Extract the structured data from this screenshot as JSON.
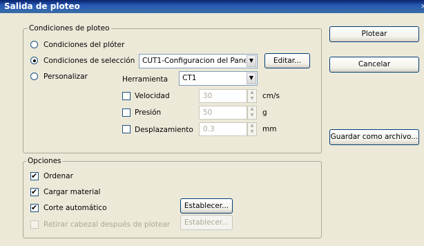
{
  "window": {
    "title": "Salida de ploteo",
    "close_glyph": "x"
  },
  "plot_conditions": {
    "legend": "Condiciones de ploteo",
    "plotter_conditions": "Condiciones del plóter",
    "selection_conditions": "Condiciones de selección",
    "custom": "Personalizar",
    "selected_profile": "CUT1-Configuracion del Pane",
    "edit_button": "Editar...",
    "tool_label": "Herramienta",
    "tool_value": "CT1",
    "speed": {
      "label": "Velocidad",
      "value": "30",
      "unit": "cm/s"
    },
    "pressure": {
      "label": "Presión",
      "value": "50",
      "unit": "g"
    },
    "offset": {
      "label": "Desplazamiento",
      "value": "0.3",
      "unit": "mm"
    }
  },
  "options": {
    "legend": "Opciones",
    "sort": "Ordenar",
    "load_media": "Cargar material",
    "auto_cut": "Corte automático",
    "remove_head": "Retirar cabezal después de plotear",
    "set_button_1": "Establecer...",
    "set_button_2": "Establecer..."
  },
  "buttons": {
    "plot": "Plotear",
    "cancel": "Cancelar",
    "save_as_file": "Guardar como archivo..."
  },
  "state": {
    "selected_radio": "selection_conditions",
    "checked": [
      "sort",
      "load_media",
      "auto_cut"
    ],
    "disabled": [
      "remove_head",
      "set_button_2",
      "speed",
      "pressure",
      "offset"
    ]
  },
  "icons": {
    "dropdown": "chevron-down-icon",
    "spin_up": "spin-up-icon",
    "spin_down": "spin-down-icon",
    "close": "close-icon"
  },
  "colors": {
    "titlebar": "#0a246a",
    "dialog_bg": "#ece9d8",
    "button_border": "#003c74",
    "disabled_text": "#aca899"
  }
}
